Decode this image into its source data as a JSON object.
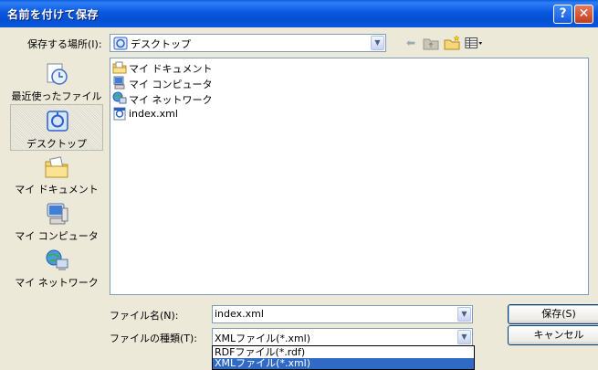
{
  "window": {
    "title": "名前を付けて保存",
    "help_glyph": "?",
    "close_glyph": "✕"
  },
  "savein": {
    "label": "保存する場所(I):",
    "value": "デスクトップ"
  },
  "toolbar": {
    "icons": [
      "back-arrow-icon",
      "up-folder-icon",
      "new-folder-icon",
      "view-menu-icon"
    ]
  },
  "places": [
    {
      "label": "最近使ったファイル",
      "icon": "recent-icon"
    },
    {
      "label": "デスクトップ",
      "icon": "desktop-icon"
    },
    {
      "label": "マイ ドキュメント",
      "icon": "my-documents-icon"
    },
    {
      "label": "マイ コンピュータ",
      "icon": "my-computer-icon"
    },
    {
      "label": "マイ ネットワーク",
      "icon": "my-network-icon"
    }
  ],
  "files": [
    {
      "name": "マイ ドキュメント",
      "icon": "my-documents-icon"
    },
    {
      "name": "マイ コンピュータ",
      "icon": "my-computer-icon"
    },
    {
      "name": "マイ ネットワーク",
      "icon": "my-network-icon"
    },
    {
      "name": "index.xml",
      "icon": "xml-file-icon"
    }
  ],
  "filename": {
    "label": "ファイル名(N):",
    "value": "index.xml"
  },
  "filetype": {
    "label": "ファイルの種類(T):",
    "value": "XMLファイル(*.xml)",
    "options": [
      "RDFファイル(*.rdf)",
      "XMLファイル(*.xml)"
    ],
    "selected_index": 1
  },
  "buttons": {
    "save": "保存(S)",
    "cancel": "キャンセル"
  },
  "colors": {
    "titlebar": "#0a58e0",
    "selection": "#316ac5",
    "dialog_bg": "#ece9d8"
  }
}
